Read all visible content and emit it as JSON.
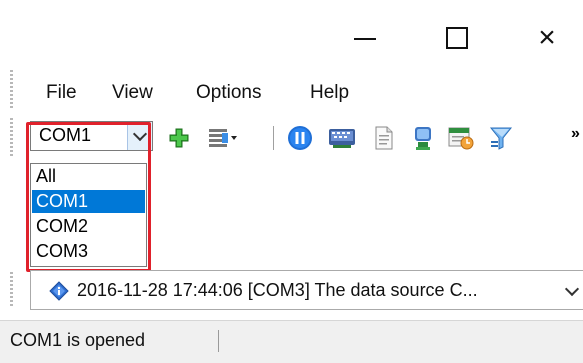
{
  "window": {
    "minimize_icon": "minimize-icon",
    "maximize_icon": "maximize-icon",
    "close_icon": "close-icon",
    "close_glyph": "×"
  },
  "menu": {
    "items": [
      {
        "label": "File"
      },
      {
        "label": "View"
      },
      {
        "label": "Options"
      },
      {
        "label": "Help"
      }
    ]
  },
  "toolbar": {
    "port_selected": "COM1",
    "icons": [
      "add-icon",
      "columns-icon",
      "pause-icon",
      "serial-device-icon",
      "document-icon",
      "monitor-icon",
      "scheduler-icon",
      "filter-icon"
    ],
    "overflow_label": "»"
  },
  "dropdown": {
    "options": [
      {
        "label": "All",
        "selected": false
      },
      {
        "label": "COM1",
        "selected": true
      },
      {
        "label": "COM2",
        "selected": false
      },
      {
        "label": "COM3",
        "selected": false
      }
    ],
    "highlight_color": "#e0212b",
    "selected_color": "#0078d7"
  },
  "log": {
    "entry": "2016-11-28 17:44:06 [COM3] The data source C...",
    "icon": "info-diamond-icon"
  },
  "status": {
    "text": "COM1 is opened"
  }
}
